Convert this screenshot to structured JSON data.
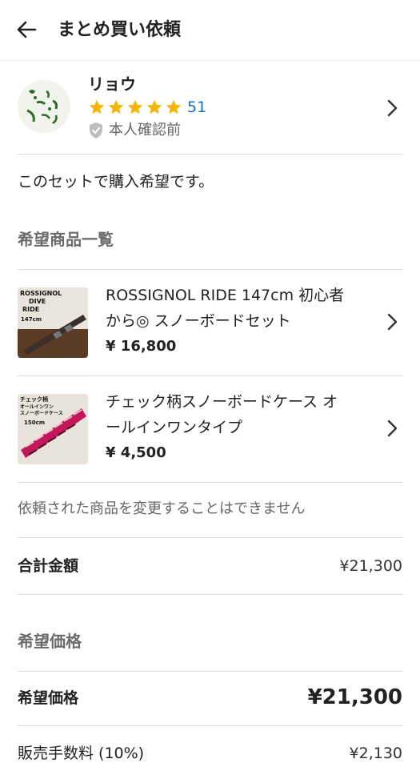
{
  "header": {
    "back_icon": "arrow-left-icon",
    "title": "まとめ買い依頼"
  },
  "seller": {
    "name": "リョウ",
    "stars": 5,
    "rating_count": "51",
    "verify_status": "本人確認前",
    "star_color": "#f5b400"
  },
  "message": "このセットで購入希望です。",
  "products_section": {
    "title": "希望商品一覧",
    "items": [
      {
        "name_line1": "ROSSIGNOL RIDE 147cm 初心者",
        "name_line2": "から◎ スノーボードセット",
        "price": "¥ 16,800",
        "thumb_text": [
          "ROSSIGNOL",
          "DIVE",
          "RIDE",
          "147cm"
        ]
      },
      {
        "name_line1": "チェック柄スノーボードケース オ",
        "name_line2": "ールインワンタイプ",
        "price": "¥ 4,500",
        "thumb_text": [
          "チェック柄",
          "オールインワン",
          "スノーボードケース",
          "150cm"
        ]
      }
    ]
  },
  "notice": "依頼された商品を変更することはできません",
  "total": {
    "label": "合計金額",
    "value": "¥21,300"
  },
  "desired_section": {
    "title": "希望価格"
  },
  "desired_price": {
    "label": "希望価格",
    "value": "¥21,300"
  },
  "fee": {
    "label": "販売手数料 (10%)",
    "value": "¥2,130"
  }
}
